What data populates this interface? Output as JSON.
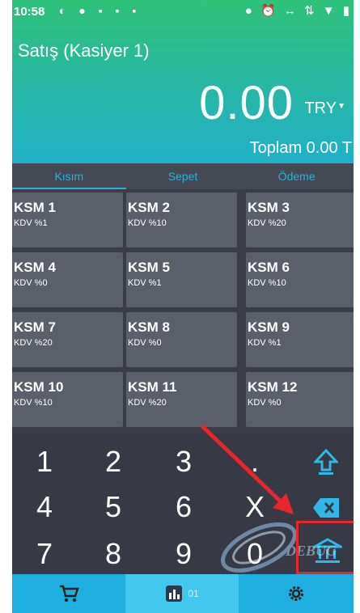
{
  "status_bar": {
    "time": "10:58"
  },
  "header": {
    "title": "Satış (Kasiyer 1)",
    "amount": "0.00",
    "currency": "TRY",
    "total": "Toplam 0.00 T"
  },
  "tabs": [
    {
      "label": "Kısım",
      "active": true
    },
    {
      "label": "Sepet",
      "active": false
    },
    {
      "label": "Ödeme",
      "active": false
    }
  ],
  "departments": [
    {
      "name": "KSM 1",
      "vat": "KDV %1"
    },
    {
      "name": "KSM 2",
      "vat": "KDV %10"
    },
    {
      "name": "KSM 3",
      "vat": "KDV %20"
    },
    {
      "name": "KSM 4",
      "vat": "KDV %0"
    },
    {
      "name": "KSM 5",
      "vat": "KDV %1"
    },
    {
      "name": "KSM 6",
      "vat": "KDV %10"
    },
    {
      "name": "KSM 7",
      "vat": "KDV %20"
    },
    {
      "name": "KSM 8",
      "vat": "KDV %0"
    },
    {
      "name": "KSM 9",
      "vat": "KDV %1"
    },
    {
      "name": "KSM 10",
      "vat": "KDV %10"
    },
    {
      "name": "KSM 11",
      "vat": "KDV %20"
    },
    {
      "name": "KSM 12",
      "vat": "KDV %0"
    }
  ],
  "keypad": {
    "k1": "1",
    "k2": "2",
    "k3": "3",
    "kdot": ".",
    "k4": "4",
    "k5": "5",
    "k6": "6",
    "kx": "X",
    "k7": "7",
    "k8": "8",
    "k9": "9",
    "k0": "0"
  },
  "bottom_nav": {
    "report_count": "01"
  },
  "icons": {
    "shift": "shift-up-icon",
    "backspace": "backspace-icon",
    "bank": "bank-icon",
    "cart": "cart-icon",
    "report": "bar-chart-icon",
    "settings": "gear-icon"
  },
  "colors": {
    "accent": "#26b3d6",
    "highlight": "#e8262d",
    "nav": "#1eaee0"
  }
}
